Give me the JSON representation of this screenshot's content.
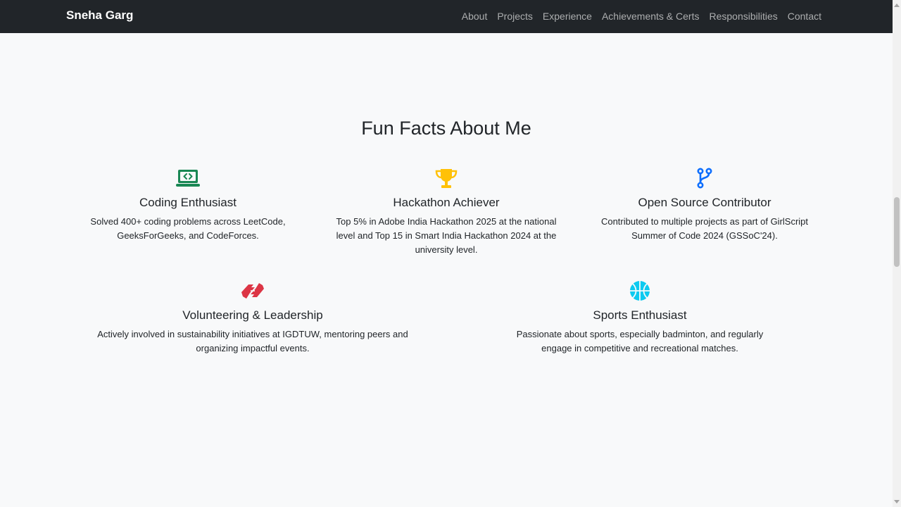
{
  "navbar": {
    "brand": "Sneha Garg",
    "links": [
      "About",
      "Projects",
      "Experience",
      "Achievements & Certs",
      "Responsibilities",
      "Contact"
    ]
  },
  "section": {
    "title": "Fun Facts About Me"
  },
  "facts": [
    {
      "icon": "laptop-code-icon",
      "color": "#198754",
      "title": "Coding Enthusiast",
      "text": "Solved 400+ coding problems across LeetCode, GeeksForGeeks, and CodeForces."
    },
    {
      "icon": "trophy-icon",
      "color": "#ffc107",
      "title": "Hackathon Achiever",
      "text": "Top 5% in Adobe India Hackathon 2025 at the national level and Top 15 in Smart India Hackathon 2024 at the university level."
    },
    {
      "icon": "git-branch-icon",
      "color": "#0d6efd",
      "title": "Open Source Contributor",
      "text": "Contributed to multiple projects as part of GirlScript Summer of Code 2024 (GSSoC'24)."
    },
    {
      "icon": "handshake-icon",
      "color": "#dc3545",
      "title": "Volunteering & Leadership",
      "text": "Actively involved in sustainability initiatives at IGDTUW, mentoring peers and organizing impactful events."
    },
    {
      "icon": "basketball-icon",
      "color": "#0dcaf0",
      "title": "Sports Enthusiast",
      "text": "Passionate about sports, especially badminton, and regularly engage in competitive and recreational matches."
    }
  ]
}
